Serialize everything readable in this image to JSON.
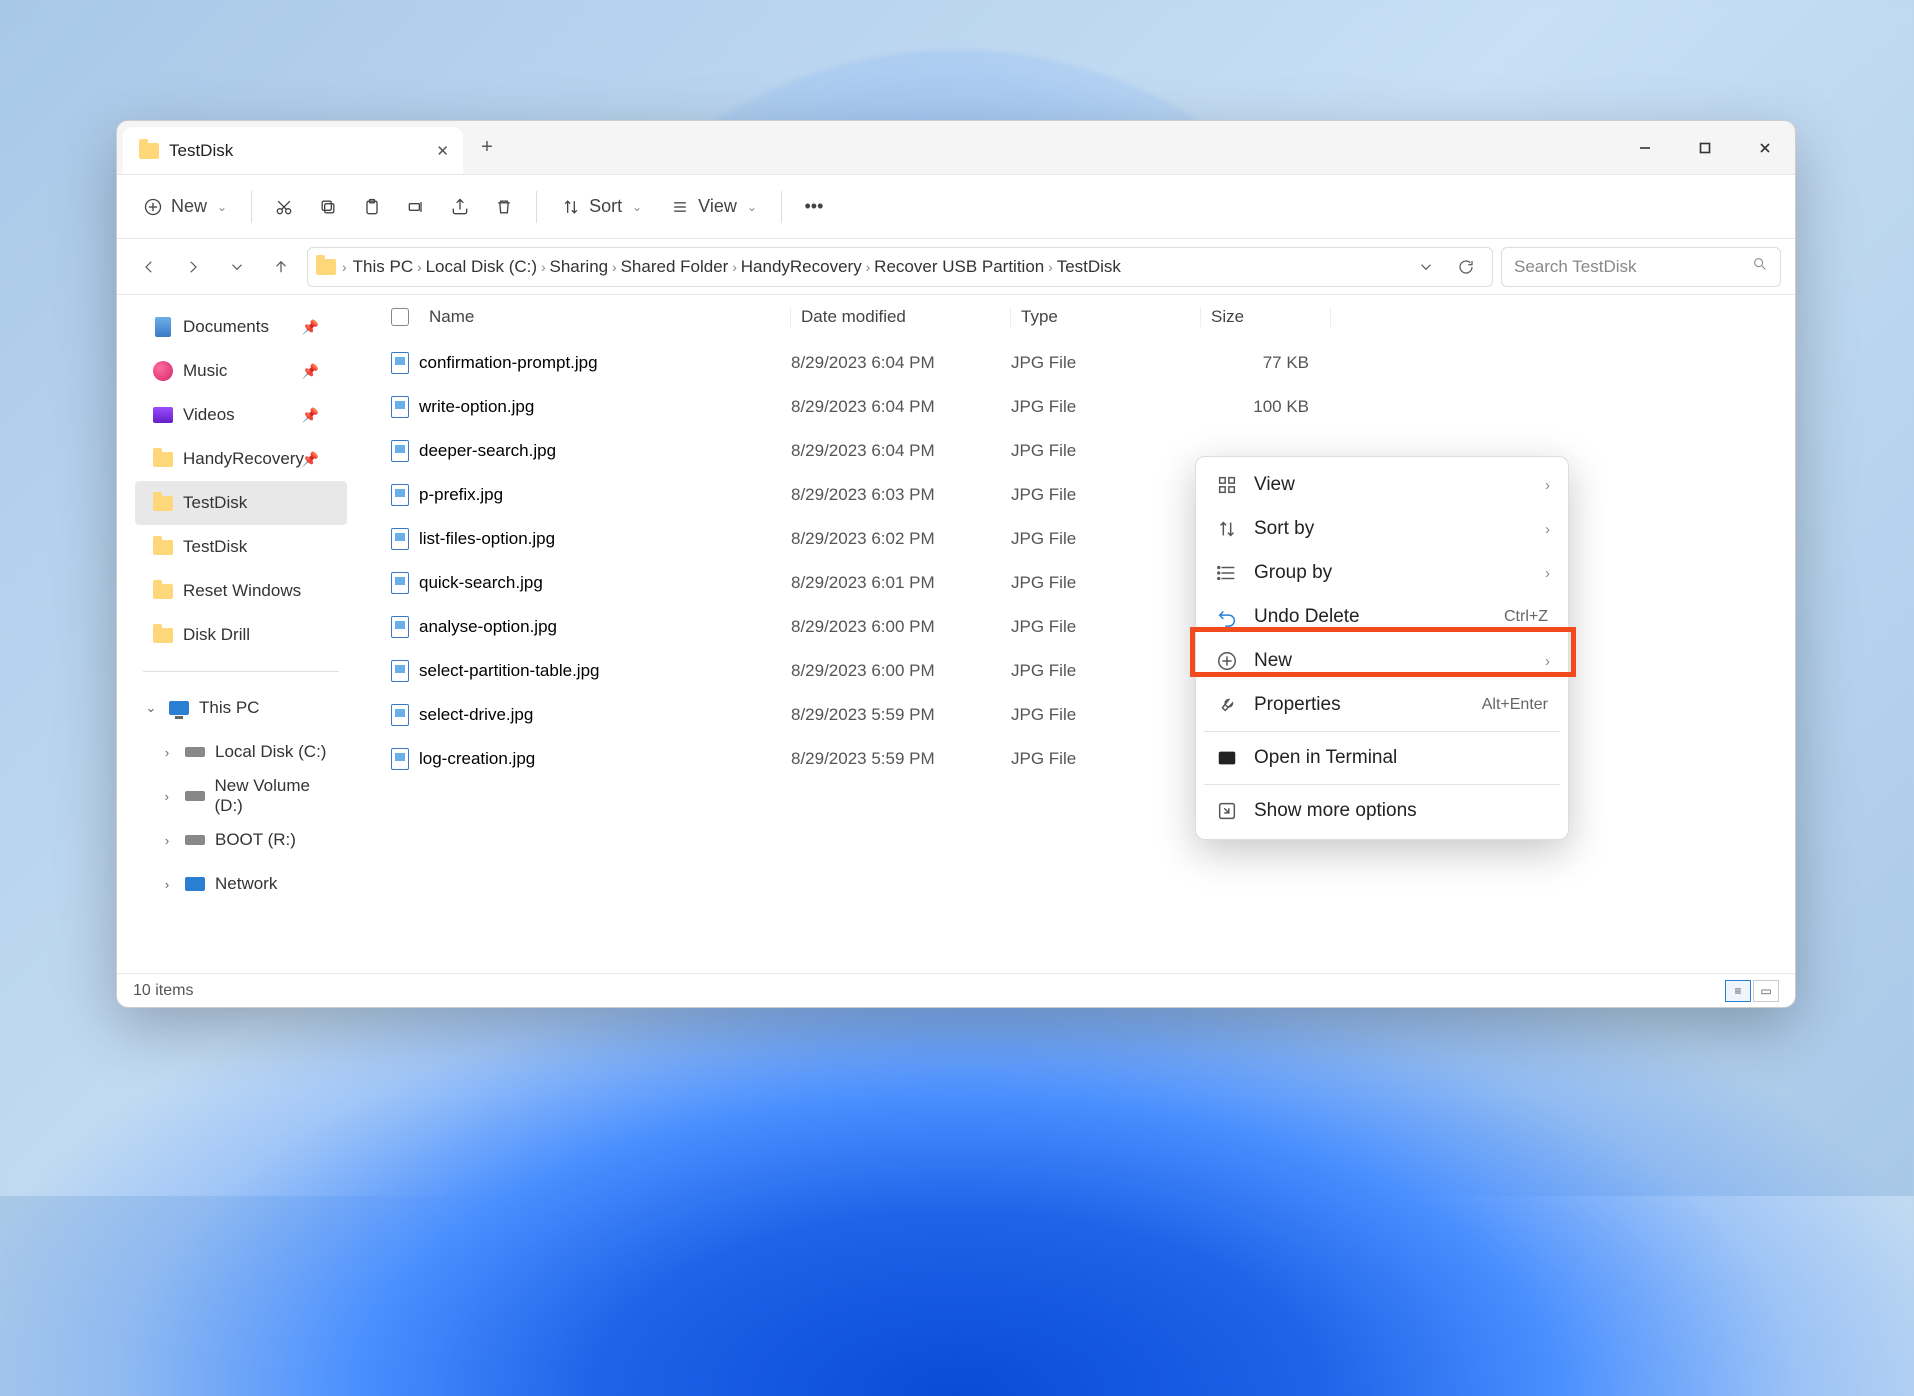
{
  "tab": {
    "title": "TestDisk"
  },
  "toolbar": {
    "new": "New",
    "sort": "Sort",
    "view": "View"
  },
  "breadcrumbs": [
    "This PC",
    "Local Disk (C:)",
    "Sharing",
    "Shared Folder",
    "HandyRecovery",
    "Recover USB Partition",
    "TestDisk"
  ],
  "search": {
    "placeholder": "Search TestDisk"
  },
  "sidebar": {
    "quick": [
      {
        "label": "Documents",
        "pinned": true,
        "icon": "doc"
      },
      {
        "label": "Music",
        "pinned": true,
        "icon": "music"
      },
      {
        "label": "Videos",
        "pinned": true,
        "icon": "video"
      },
      {
        "label": "HandyRecovery",
        "pinned": true,
        "icon": "folder"
      },
      {
        "label": "TestDisk",
        "pinned": false,
        "icon": "folder",
        "active": true
      },
      {
        "label": "TestDisk",
        "pinned": false,
        "icon": "folder"
      },
      {
        "label": "Reset Windows",
        "pinned": false,
        "icon": "folder"
      },
      {
        "label": "Disk Drill",
        "pinned": false,
        "icon": "folder"
      }
    ],
    "thispc": {
      "label": "This PC",
      "drives": [
        {
          "label": "Local Disk (C:)"
        },
        {
          "label": "New Volume (D:)"
        },
        {
          "label": "BOOT (R:)"
        }
      ],
      "network": "Network"
    }
  },
  "columns": {
    "name": "Name",
    "date": "Date modified",
    "type": "Type",
    "size": "Size"
  },
  "files": [
    {
      "name": "confirmation-prompt.jpg",
      "date": "8/29/2023 6:04 PM",
      "type": "JPG File",
      "size": "77 KB"
    },
    {
      "name": "write-option.jpg",
      "date": "8/29/2023 6:04 PM",
      "type": "JPG File",
      "size": "100 KB"
    },
    {
      "name": "deeper-search.jpg",
      "date": "8/29/2023 6:04 PM",
      "type": "JPG File",
      "size": ""
    },
    {
      "name": "p-prefix.jpg",
      "date": "8/29/2023 6:03 PM",
      "type": "JPG File",
      "size": ""
    },
    {
      "name": "list-files-option.jpg",
      "date": "8/29/2023 6:02 PM",
      "type": "JPG File",
      "size": ""
    },
    {
      "name": "quick-search.jpg",
      "date": "8/29/2023 6:01 PM",
      "type": "JPG File",
      "size": ""
    },
    {
      "name": "analyse-option.jpg",
      "date": "8/29/2023 6:00 PM",
      "type": "JPG File",
      "size": ""
    },
    {
      "name": "select-partition-table.jpg",
      "date": "8/29/2023 6:00 PM",
      "type": "JPG File",
      "size": ""
    },
    {
      "name": "select-drive.jpg",
      "date": "8/29/2023 5:59 PM",
      "type": "JPG File",
      "size": ""
    },
    {
      "name": "log-creation.jpg",
      "date": "8/29/2023 5:59 PM",
      "type": "JPG File",
      "size": ""
    }
  ],
  "status": {
    "count": "10 items"
  },
  "context_menu": [
    {
      "label": "View",
      "icon": "grid",
      "submenu": true
    },
    {
      "label": "Sort by",
      "icon": "sort",
      "submenu": true
    },
    {
      "label": "Group by",
      "icon": "group",
      "submenu": true
    },
    {
      "label": "Undo Delete",
      "icon": "undo",
      "shortcut": "Ctrl+Z",
      "highlight": true
    },
    {
      "label": "New",
      "icon": "plus",
      "submenu": true
    },
    {
      "label": "Properties",
      "icon": "wrench",
      "shortcut": "Alt+Enter"
    },
    {
      "sep": true
    },
    {
      "label": "Open in Terminal",
      "icon": "terminal"
    },
    {
      "sep": true
    },
    {
      "label": "Show more options",
      "icon": "more"
    }
  ]
}
